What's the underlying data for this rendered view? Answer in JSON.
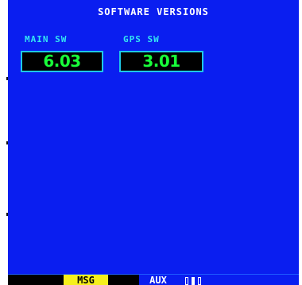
{
  "page": {
    "title": "SOFTWARE VERSIONS"
  },
  "fields": [
    {
      "label": "MAIN SW",
      "value": "6.03"
    },
    {
      "label": "GPS SW",
      "value": "3.01"
    }
  ],
  "status_bar": {
    "message_indicator": "MSG",
    "page_group": "AUX",
    "page_pips": [
      {
        "state": "inactive"
      },
      {
        "state": "active"
      },
      {
        "state": "inactive"
      }
    ]
  },
  "colors": {
    "background": "#0a1ef0",
    "label": "#33e6f2",
    "value": "#18ff3a",
    "box_border": "#1ec8e6",
    "message": "#f5ef1c"
  }
}
